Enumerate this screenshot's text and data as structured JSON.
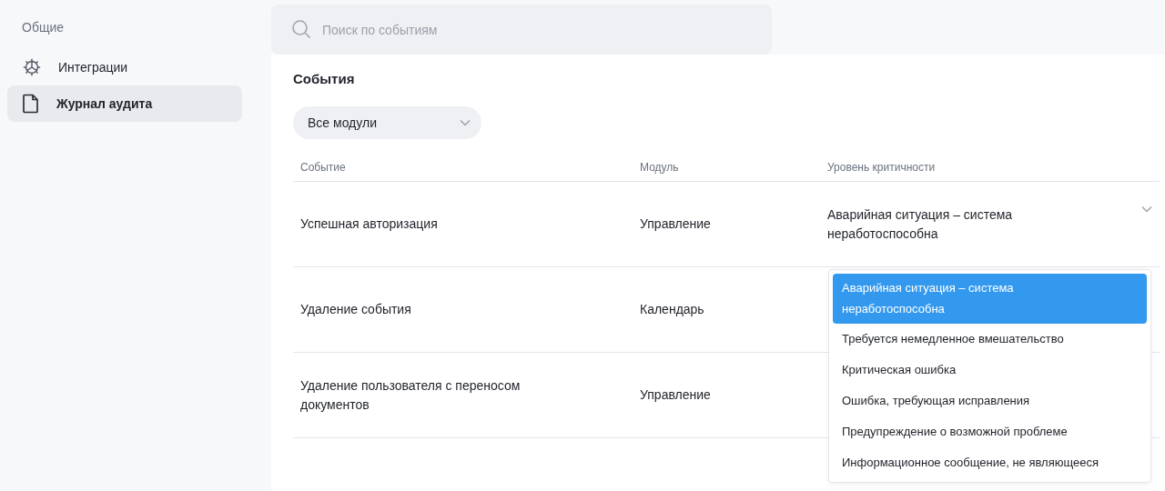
{
  "sidebar": {
    "section": "Общие",
    "items": [
      {
        "label": "Интеграции",
        "kind": "gear",
        "selected": false
      },
      {
        "label": "Журнал аудита",
        "kind": "document",
        "selected": true
      }
    ]
  },
  "search": {
    "placeholder": "Поиск по событиям"
  },
  "title": "События",
  "module_filter": {
    "value": "Все модули"
  },
  "table": {
    "columns": [
      "Событие",
      "Модуль",
      "Уровень критичности"
    ],
    "rows": [
      {
        "event": "Успешная авторизация",
        "module": "Управление",
        "severity": "Аварийная ситуация – система неработоспособна"
      },
      {
        "event": "Удаление события",
        "module": "Календарь"
      },
      {
        "event": "Удаление пользователя с переносом документов",
        "module": "Управление"
      }
    ]
  },
  "severity_menu": {
    "options": [
      {
        "label": "Аварийная ситуация – система неработоспособна",
        "selected": true
      },
      {
        "label": "Требуется немедленное вмешательство",
        "selected": false
      },
      {
        "label": "Критическая ошибка",
        "selected": false
      },
      {
        "label": "Ошибка, требующая исправления",
        "selected": false
      },
      {
        "label": "Предупреждение о возможной проблеме",
        "selected": false
      },
      {
        "label": "Информационное сообщение, не являющееся",
        "selected": false
      }
    ]
  }
}
